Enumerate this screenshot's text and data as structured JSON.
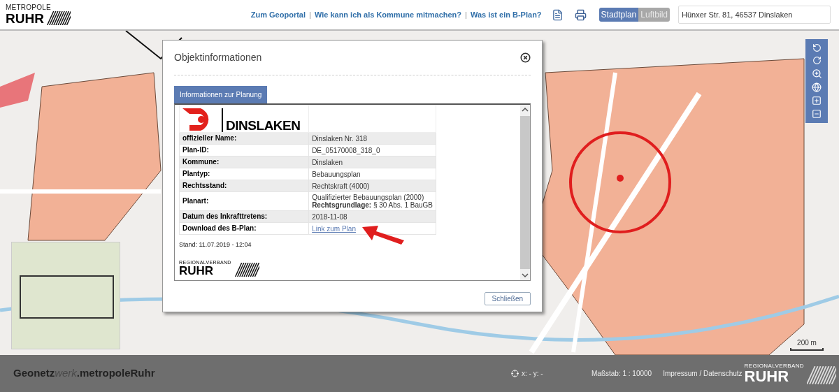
{
  "header": {
    "logo": {
      "top": "METROPOLE",
      "main": "RUHR"
    },
    "links": [
      "Zum Geoportal",
      "Wie kann ich als Kommune mitmachen?",
      "Was ist ein B-Plan?"
    ],
    "separator": "|",
    "map_toggle": [
      {
        "label": "Stadtplan",
        "selected": true
      },
      {
        "label": "Luftbild",
        "selected": false
      }
    ],
    "search": {
      "value": "Hünxer Str. 81, 46537 Dinslaken"
    }
  },
  "map": {
    "scale_bar": "200 m"
  },
  "dialog": {
    "title": "Objektinformationen",
    "tabs": [
      {
        "label": "Informationen zur Planung",
        "selected": true
      }
    ],
    "logo_text": "DINSLAKEN",
    "rows": [
      {
        "label": "offizieller Name:",
        "kind": "text",
        "value": [
          "Dinslaken Nr. 318"
        ]
      },
      {
        "label": "Plan-ID:",
        "kind": "text",
        "value": [
          "DE_05170008_318_0"
        ]
      },
      {
        "label": "Kommune:",
        "kind": "text",
        "value": [
          "Dinslaken"
        ]
      },
      {
        "label": "Plantyp:",
        "kind": "text",
        "value": [
          "Bebauungsplan"
        ]
      },
      {
        "label": "Rechtsstand:",
        "kind": "text",
        "value": [
          "Rechtskraft (4000)"
        ]
      },
      {
        "label": "Planart:",
        "kind": "text",
        "value": [
          "Qualifizierter Bebauungsplan (2000)",
          "**Rechtsgrundlage:** § 30 Abs. 1 BauGB"
        ]
      },
      {
        "label": "Datum des Inkrafttretens:",
        "kind": "text",
        "value": [
          "2018-11-08"
        ]
      },
      {
        "label": "Download des B-Plan:",
        "kind": "link",
        "value": [
          "Link zum Plan"
        ]
      }
    ],
    "stand": "Stand: 11.07.2019 - 12:04",
    "footer_logo": {
      "top": "REGIONALVERBAND",
      "main": "RUHR"
    },
    "close_button": "Schließen"
  },
  "footer": {
    "brand": [
      {
        "text": "Geonetz",
        "italic": false
      },
      {
        "text": "werk",
        "italic": true
      },
      {
        "text": ".metropoleRuhr",
        "italic": false
      }
    ],
    "coordinates": "x: - y: -",
    "scale": "Maßstab: 1 : 10000",
    "links": "Impressum / Datenschutz",
    "logo": {
      "top": "REGIONALVERBAND",
      "main": "RUHR"
    }
  }
}
